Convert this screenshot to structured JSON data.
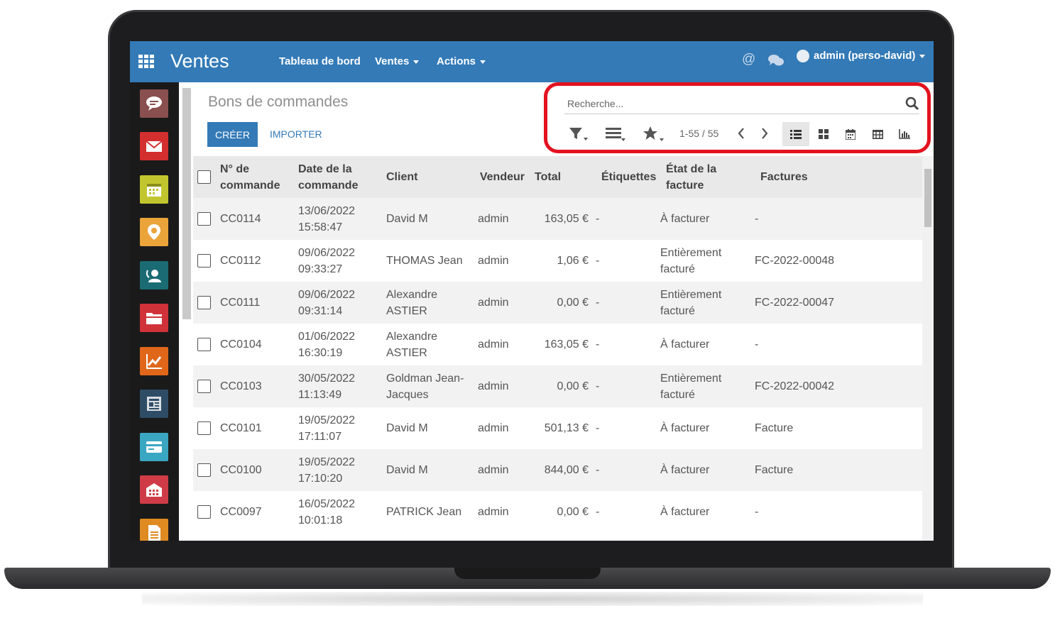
{
  "app": {
    "title": "Ventes",
    "nav": {
      "dashboard": "Tableau de bord",
      "sales": "Ventes",
      "actions": "Actions"
    },
    "user": "admin (perso-david)",
    "at_symbol": "@"
  },
  "sidebar_apps": [
    {
      "icon": "chat-icon",
      "color": "#8a4f4f"
    },
    {
      "icon": "mail-icon",
      "color": "#d32f2f"
    },
    {
      "icon": "calendar-icon",
      "color": "#c2c62e"
    },
    {
      "icon": "map-pin-icon",
      "color": "#eaa43a"
    },
    {
      "icon": "contact-icon",
      "color": "#1a6b73"
    },
    {
      "icon": "folder-icon",
      "color": "#d03239"
    },
    {
      "icon": "chart-icon",
      "color": "#e0671a"
    },
    {
      "icon": "newspaper-icon",
      "color": "#2e4c66"
    },
    {
      "icon": "card-icon",
      "color": "#3aa6c1"
    },
    {
      "icon": "building-icon",
      "color": "#cf3c47"
    },
    {
      "icon": "document-icon",
      "color": "#e08a22"
    }
  ],
  "page": {
    "breadcrumb": "Bons de commandes",
    "create_label": "CRÉER",
    "import_label": "IMPORTER",
    "search_placeholder": "Recherche...",
    "pager": "1-55 / 55"
  },
  "table": {
    "headers": {
      "order_no": [
        "N° de",
        "commande"
      ],
      "date": [
        "Date de la",
        "commande"
      ],
      "client": "Client",
      "seller": "Vendeur",
      "total": "Total",
      "tags": "Étiquettes",
      "invoice_state": [
        "État de la",
        "facture"
      ],
      "invoices": "Factures"
    },
    "rows": [
      {
        "order": "CC0114",
        "date": "13/06/2022",
        "time": "15:58:47",
        "client": [
          "David M",
          ""
        ],
        "seller": "admin",
        "total": "163,05 €",
        "tags": "-",
        "state": [
          "À facturer",
          ""
        ],
        "invoice": "-"
      },
      {
        "order": "CC0112",
        "date": "09/06/2022",
        "time": "09:33:27",
        "client": [
          "THOMAS Jean",
          ""
        ],
        "seller": "admin",
        "total": "1,06 €",
        "tags": "-",
        "state": [
          "Entièrement",
          "facturé"
        ],
        "invoice": "FC-2022-00048"
      },
      {
        "order": "CC0111",
        "date": "09/06/2022",
        "time": "09:31:14",
        "client": [
          "Alexandre",
          "ASTIER"
        ],
        "seller": "admin",
        "total": "0,00 €",
        "tags": "-",
        "state": [
          "Entièrement",
          "facturé"
        ],
        "invoice": "FC-2022-00047"
      },
      {
        "order": "CC0104",
        "date": "01/06/2022",
        "time": "16:30:19",
        "client": [
          "Alexandre",
          "ASTIER"
        ],
        "seller": "admin",
        "total": "163,05 €",
        "tags": "-",
        "state": [
          "À facturer",
          ""
        ],
        "invoice": "-"
      },
      {
        "order": "CC0103",
        "date": "30/05/2022",
        "time": "11:13:49",
        "client": [
          "Goldman Jean-",
          "Jacques"
        ],
        "seller": "admin",
        "total": "0,00 €",
        "tags": "-",
        "state": [
          "Entièrement",
          "facturé"
        ],
        "invoice": "FC-2022-00042"
      },
      {
        "order": "CC0101",
        "date": "19/05/2022",
        "time": "17:11:07",
        "client": [
          "David M",
          ""
        ],
        "seller": "admin",
        "total": "501,13 €",
        "tags": "-",
        "state": [
          "À facturer",
          ""
        ],
        "invoice": "Facture"
      },
      {
        "order": "CC0100",
        "date": "19/05/2022",
        "time": "17:10:20",
        "client": [
          "David M",
          ""
        ],
        "seller": "admin",
        "total": "844,00 €",
        "tags": "-",
        "state": [
          "À facturer",
          ""
        ],
        "invoice": "Facture"
      },
      {
        "order": "CC0097",
        "date": "16/05/2022",
        "time": "10:01:18",
        "client": [
          "PATRICK Jean",
          ""
        ],
        "seller": "admin",
        "total": "0,00 €",
        "tags": "-",
        "state": [
          "À facturer",
          ""
        ],
        "invoice": "-"
      }
    ]
  },
  "colors": {
    "topbar": "#337ab7",
    "highlight": "#e3121f"
  }
}
